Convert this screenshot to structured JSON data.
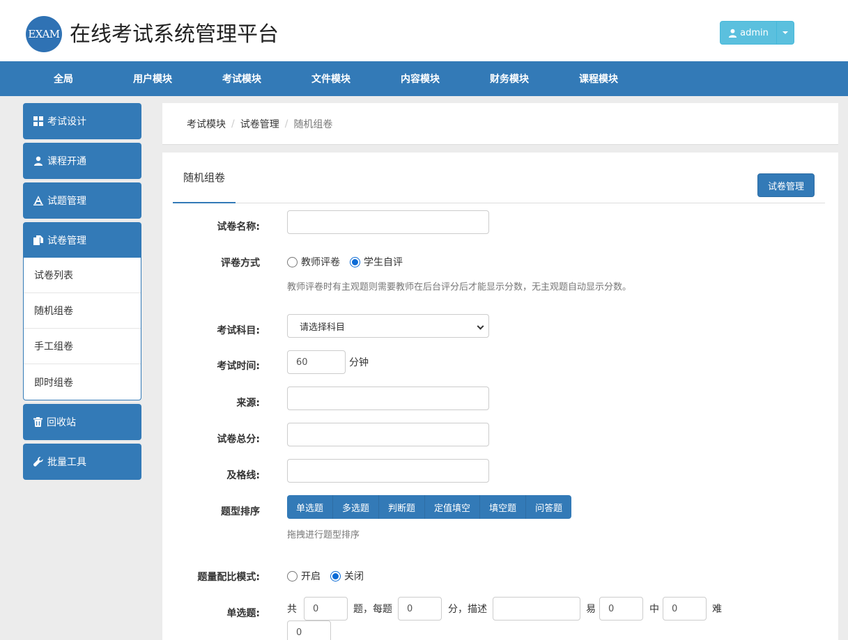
{
  "header": {
    "logo_text": "EXAM",
    "title": "在线考试系统管理平台",
    "user_label": "admin"
  },
  "nav": {
    "items": [
      "全局",
      "用户模块",
      "考试模块",
      "文件模块",
      "内容模块",
      "财务模块",
      "课程模块"
    ]
  },
  "sidebar": {
    "items": [
      {
        "label": "考试设计",
        "icon": "grid-icon"
      },
      {
        "label": "课程开通",
        "icon": "user-icon"
      },
      {
        "label": "试题管理",
        "icon": "text-icon"
      },
      {
        "label": "试卷管理",
        "icon": "copy-icon"
      },
      {
        "label": "回收站",
        "icon": "trash-icon"
      },
      {
        "label": "批量工具",
        "icon": "wrench-icon"
      }
    ],
    "submenu": [
      "试卷列表",
      "随机组卷",
      "手工组卷",
      "即时组卷"
    ]
  },
  "breadcrumb": [
    "考试模块",
    "试卷管理",
    "随机组卷"
  ],
  "tab": {
    "active_label": "随机组卷",
    "manage_button": "试卷管理"
  },
  "form": {
    "paper_name_label": "试卷名称:",
    "grading_label": "评卷方式",
    "grading_options": [
      "教师评卷",
      "学生自评"
    ],
    "grading_selected": "学生自评",
    "grading_help": "教师评卷时有主观题则需要教师在后台评分后才能显示分数，无主观题自动显示分数。",
    "subject_label": "考试科目:",
    "subject_value": "请选择科目",
    "time_label": "考试时间:",
    "time_value": "60",
    "time_unit": "分钟",
    "source_label": "来源:",
    "total_label": "试卷总分:",
    "pass_label": "及格线:",
    "order_label": "题型排序",
    "question_types": [
      "单选题",
      "多选题",
      "判断题",
      "定值填空",
      "填空题",
      "问答题"
    ],
    "order_help": "拖拽进行题型排序",
    "ratio_label": "题量配比模式:",
    "ratio_options": [
      "开启",
      "关闭"
    ],
    "ratio_selected": "关闭",
    "single_label": "单选题:",
    "single_row": {
      "total_prefix": "共",
      "count_value": "0",
      "per_text": "题，每题",
      "score_value": "0",
      "desc_text": "分，描述",
      "easy_text": "易",
      "easy_value": "0",
      "mid_text": "中",
      "mid_value": "0",
      "hard_text": "难",
      "hard_value": "0"
    }
  }
}
